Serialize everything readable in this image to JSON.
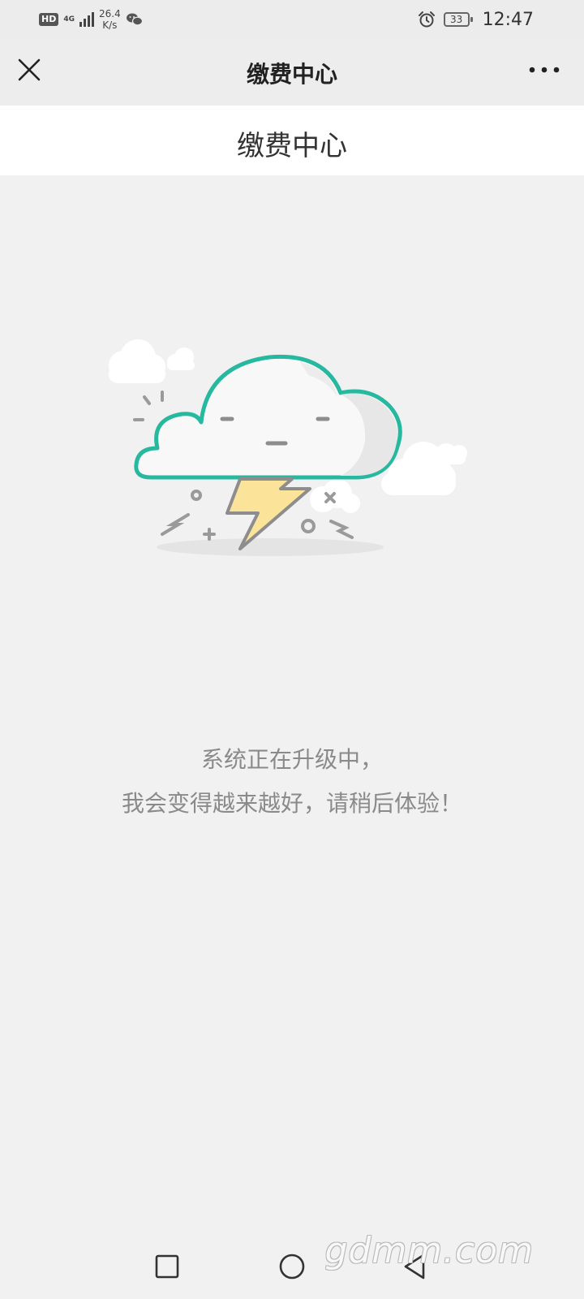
{
  "status_bar": {
    "hd": "HD",
    "network": "4G",
    "speed_value": "26.4",
    "speed_unit": "K/s",
    "battery": "33",
    "time": "12:47",
    "icons": [
      "hd-icon",
      "signal-icon",
      "wechat-icon",
      "alarm-icon",
      "battery-icon"
    ]
  },
  "title_bar": {
    "title": "缴费中心",
    "close_icon": "close-icon",
    "more_icon": "more-icon"
  },
  "page": {
    "header_title": "缴费中心",
    "message_line1": "系统正在升级中，",
    "message_line2": "我会变得越来越好，请稍后体验！",
    "illustration": "cloud-lightning-illustration"
  },
  "colors": {
    "accent_teal": "#27b9a0",
    "lightning_yellow": "#fbe49a",
    "background": "#f1f1f1"
  },
  "nav_bar": {
    "icons": [
      "recents-icon",
      "home-icon",
      "back-icon"
    ]
  },
  "watermark": "gdmm.com"
}
